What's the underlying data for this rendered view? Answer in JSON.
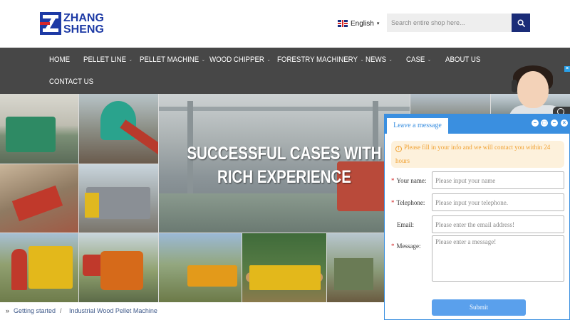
{
  "logo": {
    "line1": "ZHANG",
    "line2": "SHENG"
  },
  "language": {
    "label": "English",
    "caret": "▾"
  },
  "search": {
    "placeholder": "Search entire shop here..."
  },
  "nav": {
    "items": [
      {
        "label": "HOME",
        "has_submenu": false
      },
      {
        "label": "PELLET LINE",
        "has_submenu": true
      },
      {
        "label": "PELLET MACHINE",
        "has_submenu": true
      },
      {
        "label": "WOOD CHIPPER",
        "has_submenu": true
      },
      {
        "label": "FORESTRY MACHINERY",
        "has_submenu": true
      },
      {
        "label": "NEWS",
        "has_submenu": true
      },
      {
        "label": "CASE",
        "has_submenu": true
      },
      {
        "label": "ABOUT US",
        "has_submenu": false
      },
      {
        "label": "CONTACT US",
        "has_submenu": false
      }
    ],
    "chevron": "⌄"
  },
  "hero": {
    "headline_line1": "SUCCESSFUL CASES WITH",
    "headline_line2": "RICH EXPERIENCE"
  },
  "breadcrumb": {
    "arrow": "»",
    "item1": "Getting started",
    "separator": "/",
    "item2": "Industrial Wood Pellet Machine"
  },
  "chat": {
    "close": "×",
    "tab_label": "Leave a message",
    "notice_icon": "!",
    "notice": "Please fill in your info and we will contact you within 24 hours",
    "fields": {
      "name_label": "Your name:",
      "name_placeholder": "Please input your name",
      "phone_label": "Telephone:",
      "phone_placeholder": "Please input your telephone.",
      "email_label": "Email:",
      "email_placeholder": "Please enter the email address!",
      "message_label": "Message:",
      "message_placeholder": "Please enter a message!"
    },
    "required_mark": "*",
    "submit_label": "Submit"
  },
  "colors": {
    "brand_blue": "#1d3aa5",
    "nav_bg": "#474747",
    "search_button": "#1a2c78",
    "chat_accent": "#3a8fe0",
    "notice_text": "#f0a030",
    "submit_bg": "#5aa0ec"
  }
}
